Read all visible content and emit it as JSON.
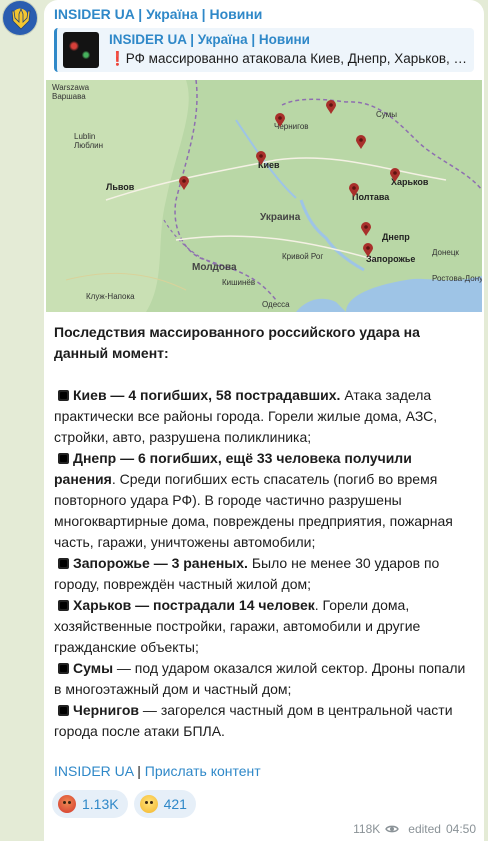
{
  "channel": {
    "name": "INSIDER UA | Україна | Новини"
  },
  "reply": {
    "title": "INSIDER UA | Україна | Новини",
    "text": "❗РФ массированно атаковала Киев, Днепр, Харьков, Запорожье, Сумы и Чернигов"
  },
  "map": {
    "labels": {
      "warszawa": "Warszawa",
      "warsaw": "Варшава",
      "lublin": "Lublin",
      "lyublin": "Люблин",
      "lviv": "Львов",
      "chernigov": "Чернигов",
      "kiev": "Киев",
      "kharkov": "Харьков",
      "poltava": "Полтава",
      "ukraine": "Украина",
      "dnepr": "Днепр",
      "zaporozhye": "Запорожье",
      "moldova": "Молдова",
      "chisinau": "Кишинёв",
      "krivoy_rog": "Кривой Рог",
      "odessa": "Одесса",
      "donetsk": "Донецк",
      "rostov": "Ростова-Дону",
      "cluj": "Клуж-Напока",
      "sumy": "Сумы"
    },
    "colors": {
      "land": "#b9d7a6",
      "water": "#9ec4e6",
      "border": "#8e6fb0",
      "pin": "#a8302b"
    }
  },
  "post": {
    "heading": "Последствия массированного российского удара на данный момент:",
    "items": [
      {
        "bold": "Киев — 4 погибших, 58 пострадавших.",
        "text": " Атака задела практически все районы города. Горели жилые дома, АЗС, стройки, авто, разрушена поликлиника;"
      },
      {
        "bold": "Днепр — 6 погибших, ещё 33 человека получили ранения",
        "text": ". Среди погибших есть спасатель (погиб во время повторного удара РФ). В городе частично разрушены многоквартирные дома, повреждены предприятия, пожарная часть, гаражи, уничтожены автомобили;"
      },
      {
        "bold": "Запорожье — 3 раненых.",
        "text": " Было не менее 30 ударов по городу, повреждён частный жилой дом;"
      },
      {
        "bold": "Харьков — пострадали 14 человек",
        "text": ". Горели дома, хозяйственные постройки, гаражи, автомобили и другие гражданские объекты;"
      },
      {
        "bold": "Сумы",
        "text": " — под ударом оказался жилой сектор. Дроны попали в многоэтажный дом и частный дом;"
      },
      {
        "bold": "Чернигов",
        "text": " — загорелся частный дом в центральной части города после атаки БПЛА."
      }
    ]
  },
  "links": {
    "channel": "INSIDER UA",
    "separator": " | ",
    "submit": "Прислать контент"
  },
  "reactions": [
    {
      "emoji": "angry-face-icon",
      "count": "1.13K"
    },
    {
      "emoji": "crying-face-icon",
      "count": "421"
    }
  ],
  "meta": {
    "views": "118K",
    "edited": "edited",
    "time": "04:50"
  }
}
